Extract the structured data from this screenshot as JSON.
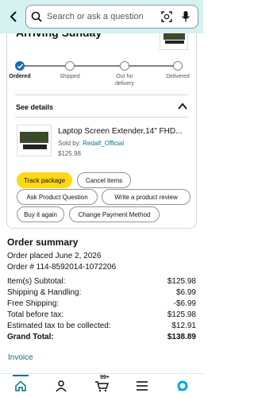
{
  "search": {
    "placeholder": "Search or ask a question"
  },
  "shipment": {
    "heading": "Arriving Sunday",
    "progress_steps": [
      {
        "label": "Ordered",
        "done": true
      },
      {
        "label": "Shipped",
        "done": false
      },
      {
        "label": "Out for\ndelivery",
        "done": false
      },
      {
        "label": "Delivered",
        "done": false
      }
    ],
    "see_details": "See details"
  },
  "item": {
    "title": "Laptop Screen Extender,14\" FHD...",
    "sold_by_label": "Sold by: ",
    "seller": "Redalf_Official",
    "price": "$125.98"
  },
  "actions": {
    "track": "Track package",
    "cancel": "Cancel items",
    "ask": "Ask Product Question",
    "review": "Write a product review",
    "buy_again": "Buy it again",
    "change_payment": "Change Payment Method"
  },
  "summary": {
    "title": "Order summary",
    "placed": "Order placed June 2, 2026",
    "order_no": "Order # 114-8592014-1072206",
    "rows": [
      {
        "label": "Item(s) Subtotal:",
        "value": "$125.98"
      },
      {
        "label": "Shipping & Handling:",
        "value": "$6.99"
      },
      {
        "label": "Free Shipping:",
        "value": "-$6.99"
      },
      {
        "label": "Total before tax:",
        "value": "$125.98"
      },
      {
        "label": "Estimated tax to be collected:",
        "value": "$12.91"
      },
      {
        "label": "Grand Total:",
        "value": "$138.89"
      }
    ],
    "invoice": "Invoice"
  },
  "nav": {
    "cart_count": "99+"
  },
  "colors": {
    "accent": "#007185",
    "primary_button": "#ffd814",
    "header_bg": "#d5f1f0",
    "progress": "#146eb4"
  }
}
